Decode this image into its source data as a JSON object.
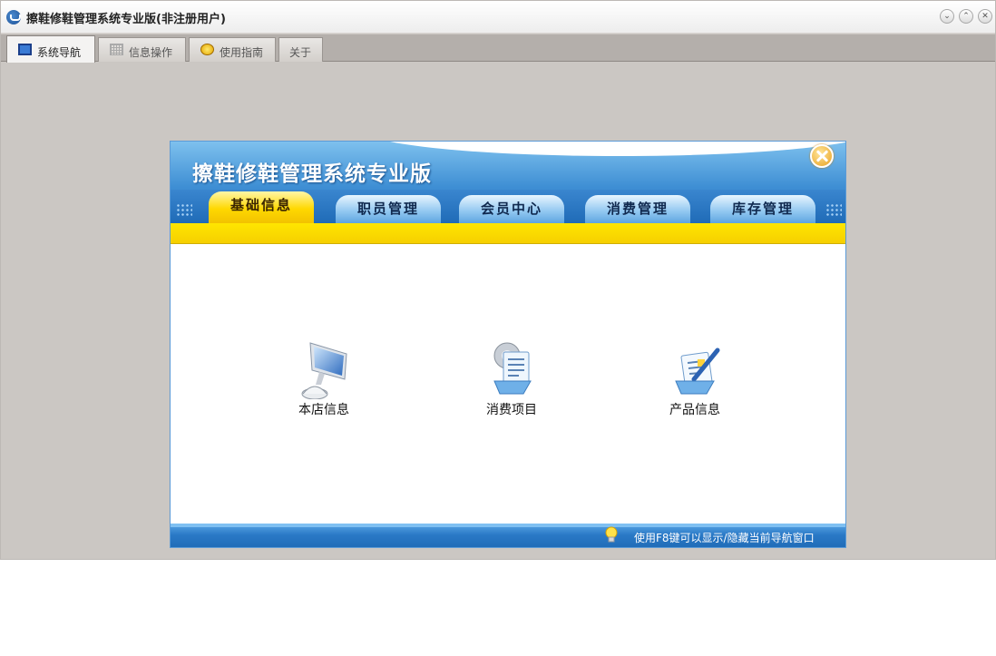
{
  "window": {
    "title": "擦鞋修鞋管理系统专业版(非注册用户)",
    "controls": {
      "minimize": "⌄",
      "maximize": "⌃",
      "close": "✕"
    }
  },
  "tabs": [
    {
      "label": "系统导航",
      "icon": "monitor-icon",
      "active": true
    },
    {
      "label": "信息操作",
      "icon": "grid-icon",
      "active": false
    },
    {
      "label": "使用指南",
      "icon": "guide-icon",
      "active": false
    },
    {
      "label": "关于",
      "icon": "",
      "active": false
    }
  ],
  "panel": {
    "title": "擦鞋修鞋管理系统专业版",
    "nav": [
      {
        "label": "基础信息",
        "active": true
      },
      {
        "label": "职员管理",
        "active": false
      },
      {
        "label": "会员中心",
        "active": false
      },
      {
        "label": "消费管理",
        "active": false
      },
      {
        "label": "库存管理",
        "active": false
      }
    ],
    "items": [
      {
        "label": "本店信息",
        "icon": "computer-icon"
      },
      {
        "label": "消费项目",
        "icon": "settings-list-icon"
      },
      {
        "label": "产品信息",
        "icon": "edit-document-icon"
      }
    ],
    "footer_hint": "使用F8键可以显示/隐藏当前导航窗口"
  },
  "colors": {
    "accent_blue": "#2a76c2",
    "active_yellow": "#ffd800",
    "window_bg": "#cbc7c3"
  }
}
